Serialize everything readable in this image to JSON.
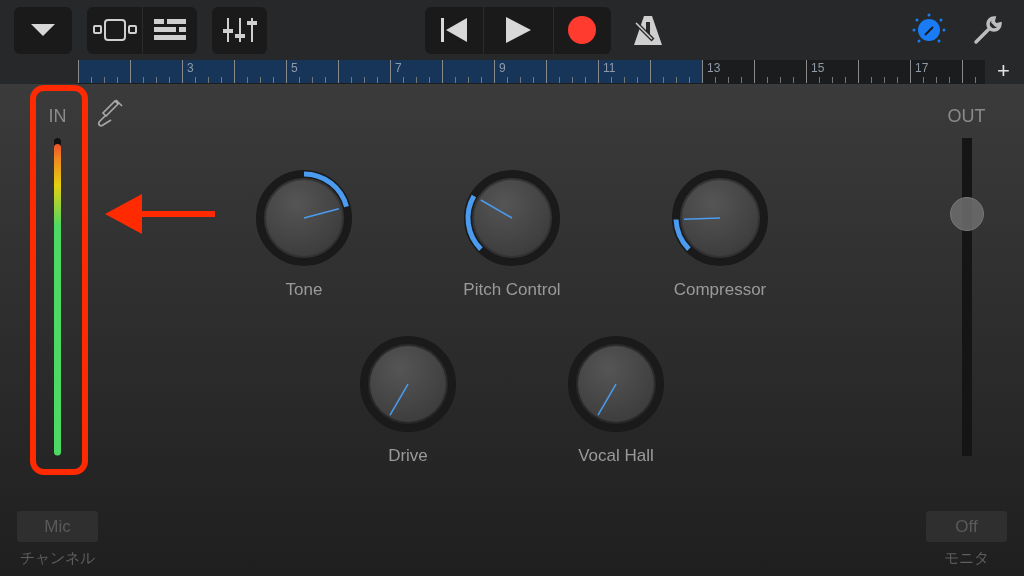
{
  "toolbar": {
    "left": [
      {
        "kind": "dropdown"
      },
      {
        "kind": "tracks"
      },
      {
        "kind": "list"
      },
      {
        "kind": "mixer"
      }
    ],
    "transport": [
      {
        "kind": "rewind"
      },
      {
        "kind": "play"
      },
      {
        "kind": "record"
      }
    ],
    "metronome": {
      "on": false
    },
    "smart_controls": {
      "on": true
    }
  },
  "ruler": {
    "bars": [
      {
        "in_region": true
      },
      {
        "in_region": true
      },
      {
        "label": "3",
        "in_region": true
      },
      {
        "in_region": true
      },
      {
        "label": "5",
        "in_region": true
      },
      {
        "in_region": true
      },
      {
        "label": "7",
        "in_region": true
      },
      {
        "in_region": true
      },
      {
        "label": "9",
        "in_region": true
      },
      {
        "in_region": true
      },
      {
        "label": "11",
        "in_region": true
      },
      {
        "in_region": true
      },
      {
        "label": "13",
        "in_region": false
      },
      {
        "in_region": false
      },
      {
        "label": "15",
        "in_region": false
      },
      {
        "in_region": false
      },
      {
        "label": "17",
        "in_region": false
      },
      {
        "in_region": false
      }
    ],
    "add": "+"
  },
  "input": {
    "label": "IN",
    "level": 0.98,
    "source": "Mic",
    "source_caption": "チャンネル"
  },
  "knob_rows": [
    [
      {
        "label": "Tone",
        "kind": "bipolar"
      },
      {
        "label": "Pitch Control",
        "kind": "unipolar"
      },
      {
        "label": "Compressor",
        "kind": "unipolar"
      }
    ],
    [
      {
        "label": "Drive",
        "kind": "unipolar"
      },
      {
        "label": "Vocal Hall",
        "kind": "unipolar"
      }
    ]
  ],
  "output": {
    "label": "OUT",
    "level": 0.76,
    "monitor": "Off",
    "monitor_caption": "モニタ"
  }
}
